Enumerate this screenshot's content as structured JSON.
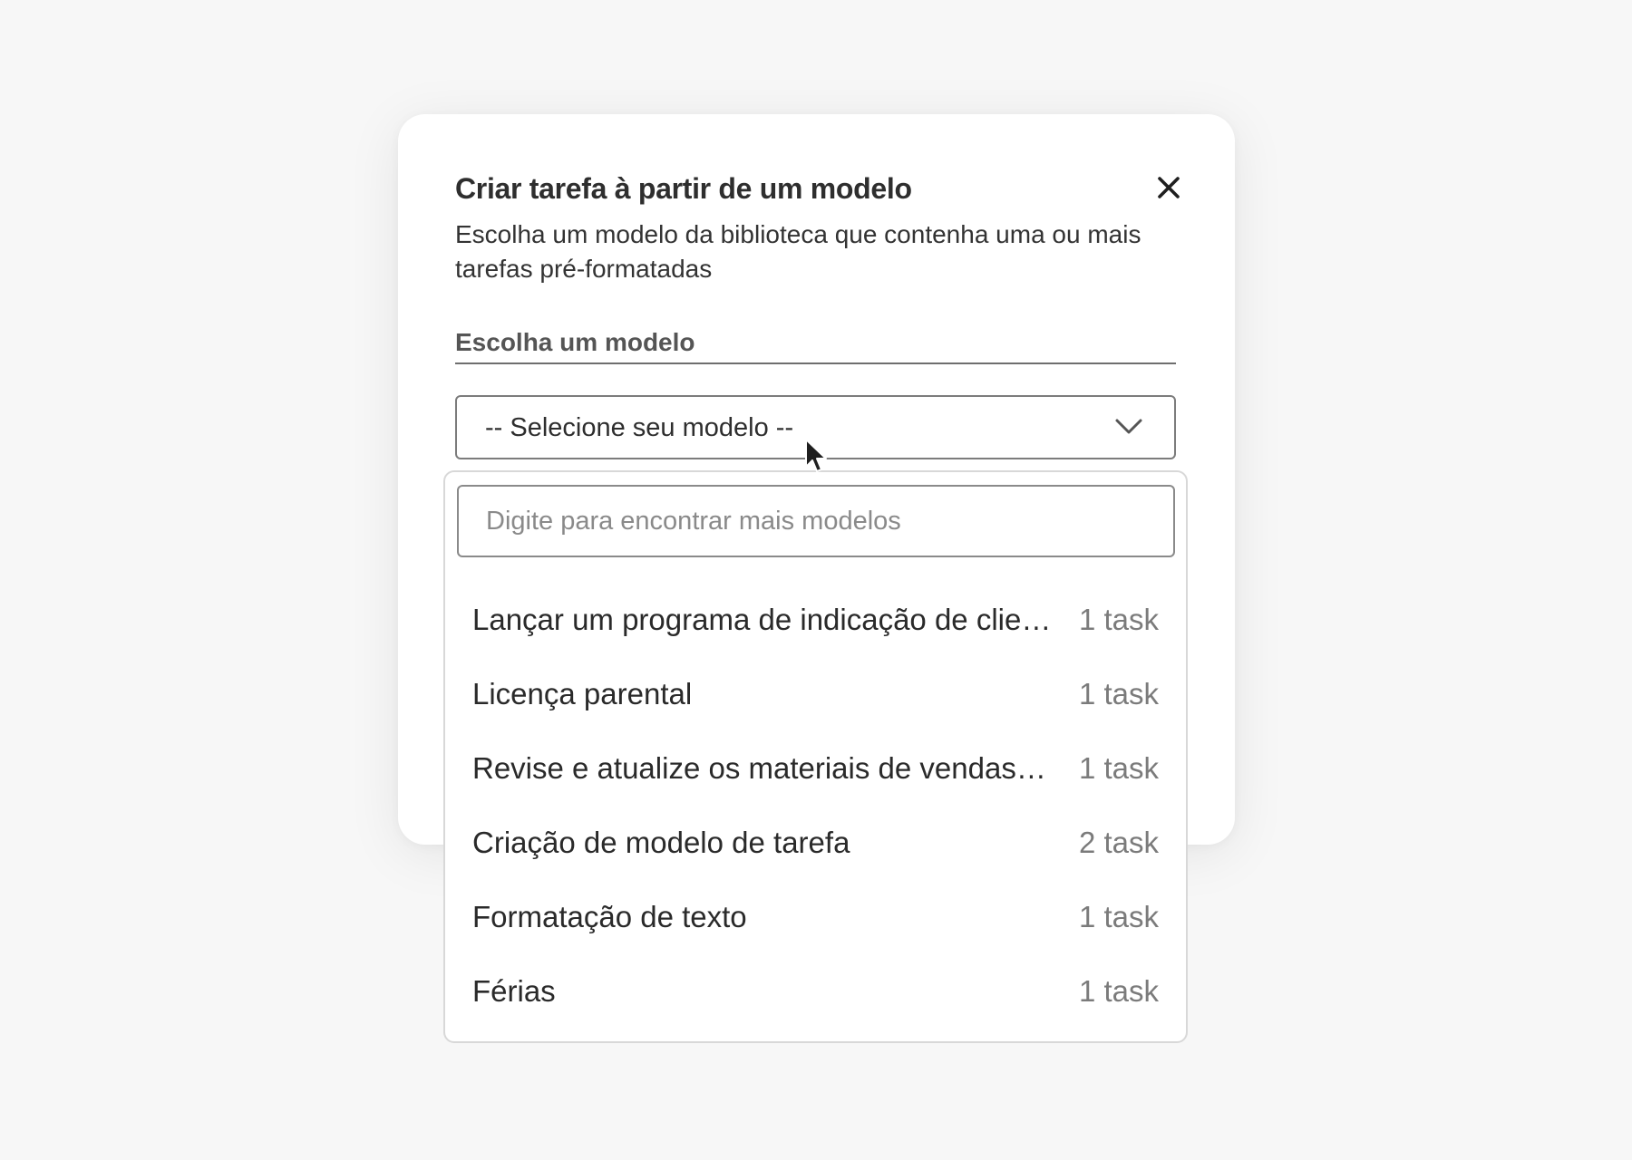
{
  "dialog": {
    "title": "Criar tarefa à partir de um modelo",
    "description": "Escolha um modelo da biblioteca que contenha uma ou mais tarefas pré-formatadas",
    "close_icon": "close-icon"
  },
  "form": {
    "section_label": "Escolha um modelo",
    "select": {
      "value": "-- Selecione seu modelo --",
      "icon": "chevron-down-icon"
    }
  },
  "dropdown": {
    "search_placeholder": "Digite para encontrar mais modelos",
    "search_value": "",
    "options": [
      {
        "label": "Lançar um programa de indicação de clien...",
        "count": "1 task"
      },
      {
        "label": "Licença parental",
        "count": "1 task"
      },
      {
        "label": "Revise e atualize os materiais de vendas p...",
        "count": "1 task"
      },
      {
        "label": "Criação de modelo de tarefa",
        "count": "2 task"
      },
      {
        "label": "Formatação de texto",
        "count": "1 task"
      },
      {
        "label": "Férias",
        "count": "1 task"
      }
    ]
  },
  "colors": {
    "background": "#f7f7f7",
    "panel": "#ffffff",
    "text": "#2e2e2e",
    "muted": "#7b7b7b"
  }
}
